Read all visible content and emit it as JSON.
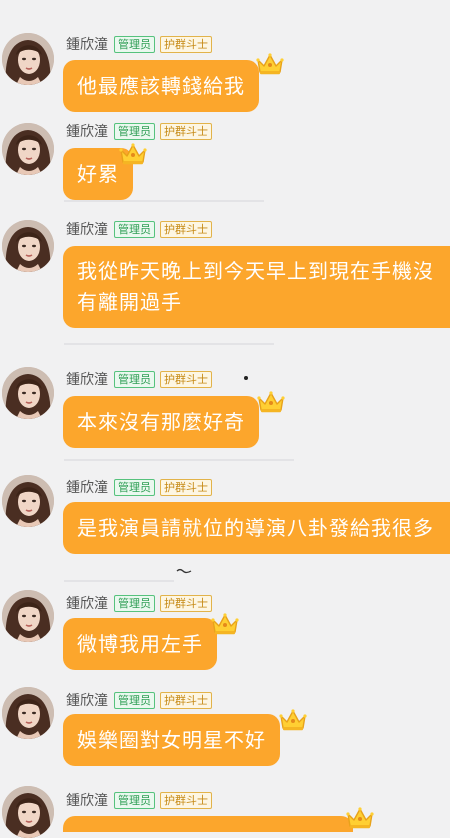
{
  "messages": [
    {
      "username": "鍾欣潼",
      "badge_admin": "管理员",
      "badge_guard": "护群斗士",
      "text": "他最應該轉錢給我"
    },
    {
      "username": "鍾欣潼",
      "badge_admin": "管理员",
      "badge_guard": "护群斗士",
      "text": "好累"
    },
    {
      "username": "鍾欣潼",
      "badge_admin": "管理员",
      "badge_guard": "护群斗士",
      "text": "我從昨天晚上到今天早上到現在手機沒有離開過手"
    },
    {
      "username": "鍾欣潼",
      "badge_admin": "管理员",
      "badge_guard": "护群斗士",
      "text": "本來沒有那麼好奇"
    },
    {
      "username": "鍾欣潼",
      "badge_admin": "管理员",
      "badge_guard": "护群斗士",
      "text": "是我演員請就位的導演八卦發給我很多"
    },
    {
      "username": "鍾欣潼",
      "badge_admin": "管理员",
      "badge_guard": "护群斗士",
      "text": "微博我用左手"
    },
    {
      "username": "鍾欣潼",
      "badge_admin": "管理员",
      "badge_guard": "护群斗士",
      "text": "娛樂圈對女明星不好"
    },
    {
      "username": "鍾欣潼",
      "badge_admin": "管理员",
      "badge_guard": "护群斗士",
      "text": ""
    }
  ],
  "icons": {
    "crown": "crown-icon",
    "avatar": "avatar"
  },
  "colors": {
    "bubble": "#fca62c",
    "background": "#f1f1f2",
    "badge_admin": "#2f9e55",
    "badge_guard": "#c68a16"
  }
}
